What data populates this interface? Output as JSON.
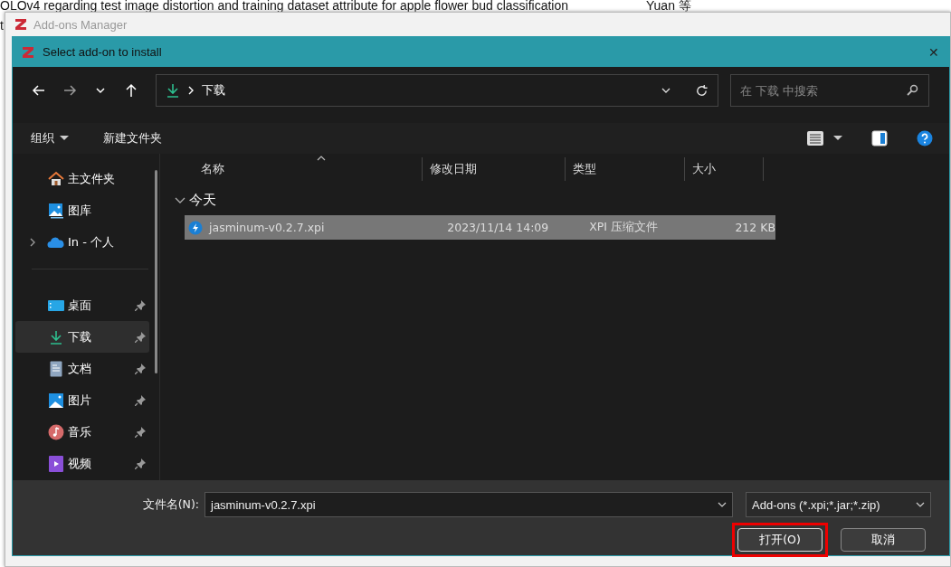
{
  "background": {
    "text": "OLOv4 regarding test image distortion and training dataset attribute for apple flower bud classification",
    "author": "Yuan 等",
    "left_char": "t"
  },
  "manager_window": {
    "title": "Add-ons Manager"
  },
  "dialog": {
    "title": "Select add-on to install",
    "close": "✕"
  },
  "address": {
    "location": "下载"
  },
  "search": {
    "placeholder": "在 下载 中搜索"
  },
  "toolbar": {
    "organize": "组织",
    "new_folder": "新建文件夹"
  },
  "sidebar": {
    "sections": [
      {
        "items": [
          {
            "label": "主文件夹",
            "kind": "home",
            "pinned": false,
            "expandable": false,
            "selected": false
          },
          {
            "label": "图库",
            "kind": "gallery",
            "pinned": false,
            "expandable": false,
            "selected": false
          },
          {
            "label": "In - 个人",
            "kind": "cloud",
            "pinned": false,
            "expandable": true,
            "selected": false
          }
        ]
      },
      {
        "items": [
          {
            "label": "桌面",
            "kind": "desktop",
            "pinned": true,
            "expandable": false,
            "selected": false
          },
          {
            "label": "下载",
            "kind": "download",
            "pinned": true,
            "expandable": false,
            "selected": true
          },
          {
            "label": "文档",
            "kind": "document",
            "pinned": true,
            "expandable": false,
            "selected": false
          },
          {
            "label": "图片",
            "kind": "pictures",
            "pinned": true,
            "expandable": false,
            "selected": false
          },
          {
            "label": "音乐",
            "kind": "music",
            "pinned": true,
            "expandable": false,
            "selected": false
          },
          {
            "label": "视频",
            "kind": "video",
            "pinned": true,
            "expandable": false,
            "selected": false
          }
        ]
      }
    ]
  },
  "table": {
    "columns": [
      "名称",
      "修改日期",
      "类型",
      "大小"
    ],
    "groups": [
      {
        "label": "今天",
        "expanded": true,
        "rows": [
          {
            "name": "jasminum-v0.2.7.xpi",
            "modified": "2023/11/14 14:09",
            "type": "XPI 压缩文件",
            "size": "212 KB",
            "selected": true
          }
        ]
      }
    ]
  },
  "footer": {
    "filename_label": "文件名(N):",
    "filename": "jasminum-v0.2.7.xpi",
    "filter": "Add-ons (*.xpi;*.jar;*.zip)",
    "buttons": [
      {
        "label": "打开(O)",
        "highlighted": true
      },
      {
        "label": "取消",
        "highlighted": false
      }
    ]
  }
}
